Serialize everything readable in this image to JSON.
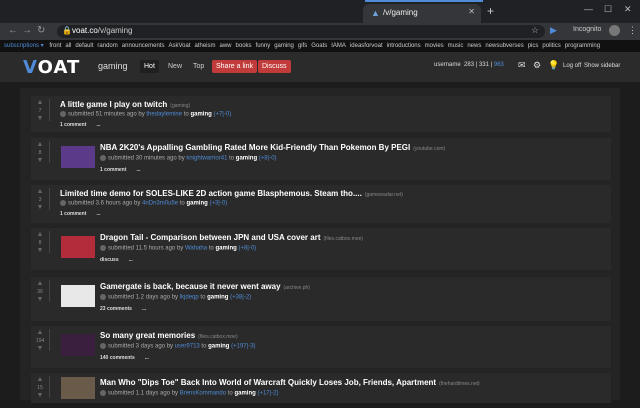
{
  "browser": {
    "tab_title": "/v/gaming",
    "new_tab": "+",
    "url_host": "voat.co",
    "url_path": "/v/gaming",
    "incognito_label": "Incognito"
  },
  "subbar": {
    "subscriptions_label": "subscriptions ▾",
    "items": [
      "front",
      "all",
      "default",
      "random",
      "announcements",
      "AskVoat",
      "atheism",
      "aww",
      "books",
      "funny",
      "gaming",
      "gifs",
      "Goats",
      "IAMA",
      "ideasforvoat",
      "introductions",
      "movies",
      "music",
      "news",
      "newsubverses",
      "pics",
      "politics",
      "programming"
    ]
  },
  "header": {
    "logo": "VOAT",
    "subverse": "gaming",
    "tabs": [
      "Hot",
      "New",
      "Top"
    ],
    "share_link": "Share a link",
    "discuss": "Discuss",
    "username": "username",
    "ccp": "283",
    "scp": "331",
    "messages": "963",
    "logout": "Log off",
    "show_sidebar": "Show sidebar"
  },
  "posts": [
    {
      "title": "A little game I play on twitch",
      "domain": "(gaming)",
      "submitted": "submitted 51 minutes ago by",
      "user": "thedaylemine",
      "to": "to",
      "sub": "gaming",
      "score": "(+7|-0)",
      "comments": "1 comment",
      "more": "...",
      "votes": "7",
      "thumb": "",
      "thumb_color": ""
    },
    {
      "title": "NBA 2K20's Appalling Gambling Rated More Kid-Friendly Than Pokemon By PEGI",
      "domain": "(youtube.com)",
      "submitted": "submitted 30 minutes ago by",
      "user": "knightwarrior41",
      "to": "to",
      "sub": "gaming",
      "score": "(+8|-0)",
      "comments": "1 comment",
      "more": "...",
      "votes": "8",
      "thumb": "yes",
      "thumb_color": "#5b3a8a"
    },
    {
      "title": "Limited time demo for SOLES-LIKE 2D action game Blasphemous. Steam tho....",
      "domain": "(gamesradar.net)",
      "submitted": "submitted 3.6 hours ago by",
      "user": "4nDn3m0u5e",
      "to": "to",
      "sub": "gaming",
      "score": "(+3|-0)",
      "comments": "1 comment",
      "more": "...",
      "votes": "3",
      "thumb": "",
      "thumb_color": ""
    },
    {
      "title": "Dragon Tail - Comparison between JPN and USA cover art",
      "domain": "(files.catbox.moe)",
      "submitted": "submitted 11.5 hours ago by",
      "user": "Wahaha",
      "to": "to",
      "sub": "gaming",
      "score": "(+8|-0)",
      "comments": "discuss",
      "more": "...",
      "votes": "8",
      "thumb": "yes",
      "thumb_color": "#b22c3b"
    },
    {
      "title": "Gamergate is back, because it never went away",
      "domain": "(archive.ph)",
      "submitted": "submitted 1.2 days ago by",
      "user": "lkjdeqp",
      "to": "to",
      "sub": "gaming",
      "score": "(+38|-2)",
      "comments": "23 comments",
      "more": "...",
      "votes": "36",
      "thumb": "yes",
      "thumb_color": "#e8e8e8"
    },
    {
      "title": "So many great memories",
      "domain": "(files.catbox.moe)",
      "submitted": "submitted 3 days ago by",
      "user": "user9713",
      "to": "to",
      "sub": "gaming",
      "score": "(+197|-3)",
      "comments": "140 comments",
      "more": "...",
      "votes": "194",
      "thumb": "yes",
      "thumb_color": "#3a1f3f"
    },
    {
      "title": "Man Who \"Dips Toe\" Back Into World of Warcraft Quickly Loses Job, Friends, Apartment",
      "domain": "(thehardtimes.net)",
      "submitted": "submitted 1.1 days ago by",
      "user": "BrensKommando",
      "to": "to",
      "sub": "gaming",
      "score": "(+17|-2)",
      "comments": "",
      "more": "",
      "votes": "15",
      "thumb": "yes",
      "thumb_color": "#6a5a4a"
    }
  ]
}
